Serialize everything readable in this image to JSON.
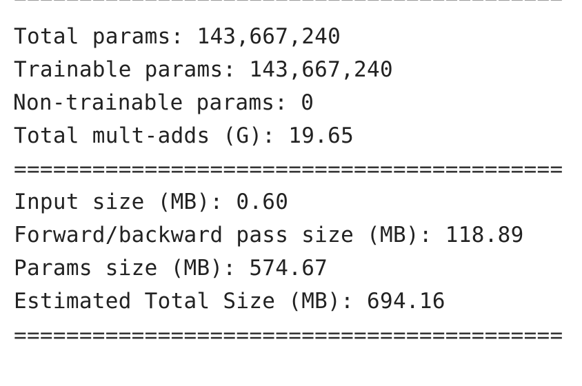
{
  "summary": {
    "separator": "==========================================",
    "total_params": "Total params: 143,667,240",
    "trainable_params": "Trainable params: 143,667,240",
    "non_trainable_params": "Non-trainable params: 0",
    "total_mult_adds": "Total mult-adds (G): 19.65",
    "input_size": "Input size (MB): 0.60",
    "forward_backward_size": "Forward/backward pass size (MB): 118.89",
    "params_size": "Params size (MB): 574.67",
    "estimated_total_size": "Estimated Total Size (MB): 694.16"
  }
}
